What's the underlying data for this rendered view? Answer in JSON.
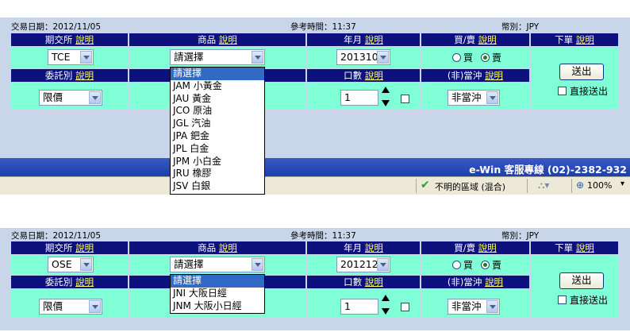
{
  "panel1": {
    "trade_date": "交易日期：2012/11/05",
    "ref_time": "參考時間：11:37",
    "currency": "幣別：JPY",
    "headers": {
      "exchange": "期交所",
      "product": "商品",
      "yearmonth": "年月",
      "buysell": "買/賣",
      "order": "下單",
      "type": "委託別",
      "qty": "口數",
      "daytrade": "(非)當沖",
      "explain": "說明"
    },
    "exchange_value": "TCE",
    "product_value": "請選擇",
    "yearmonth_value": "201310",
    "buy_label": "買",
    "sell_label": "賣",
    "type_value": "限價",
    "qty_value": "1",
    "daytrade_value": "非當沖",
    "send_label": "送出",
    "direct_label": "直接送出",
    "dropdown": [
      "請選擇",
      "JAM 小黃金",
      "JAU 黃金",
      "JCO 原油",
      "JGL 汽油",
      "JPA 鈀金",
      "JPL 白金",
      "JPM 小白金",
      "JRU 橡膠",
      "JSV 白銀"
    ]
  },
  "banner_text": "e-Win 客服專線 (02)-2382-932",
  "statusbar": {
    "zone": "不明的區域 (混合)",
    "zoom": "100%"
  },
  "panel2": {
    "trade_date": "交易日期：2012/11/05",
    "ref_time": "參考時間：11:37",
    "currency": "幣別：JPY",
    "headers": {
      "exchange": "期交所",
      "product": "商品",
      "yearmonth": "年月",
      "buysell": "買/賣",
      "order": "下單",
      "type": "委託別",
      "qty": "口數",
      "daytrade": "(非)當沖",
      "explain": "說明"
    },
    "exchange_value": "OSE",
    "product_value": "請選擇",
    "yearmonth_value": "201212",
    "buy_label": "買",
    "sell_label": "賣",
    "type_value": "限價",
    "qty_value": "1",
    "daytrade_value": "非當沖",
    "send_label": "送出",
    "direct_label": "直接送出",
    "dropdown": [
      "請選擇",
      "JNI 大阪日經",
      "JNM 大阪小日經"
    ]
  }
}
